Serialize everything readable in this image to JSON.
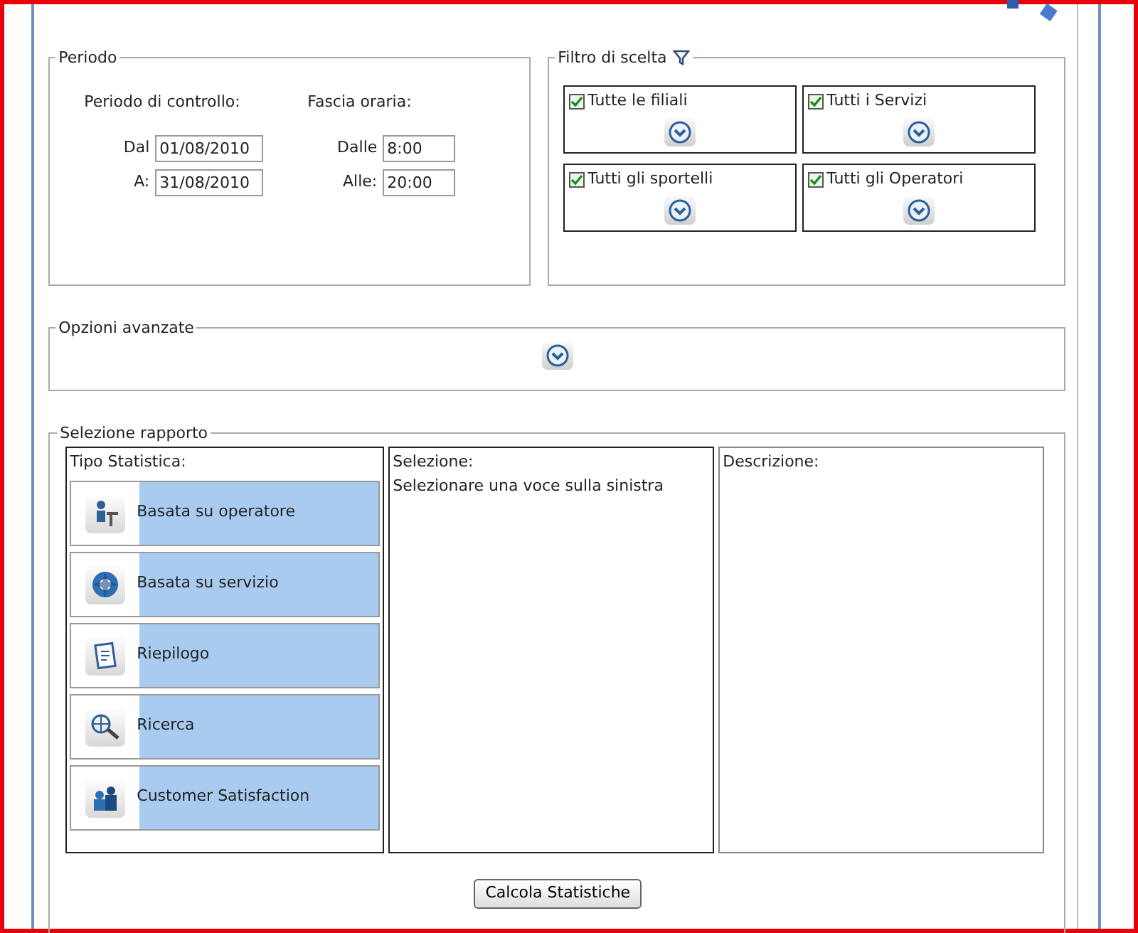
{
  "periodo": {
    "title": "Periodo",
    "control_label": "Periodo di controllo:",
    "time_label": "Fascia oraria:",
    "dates": [
      {
        "label": "Dal",
        "value": "01/08/2010"
      },
      {
        "label": "A:",
        "value": "31/08/2010"
      }
    ],
    "times": [
      {
        "label": "Dalle",
        "value": "8:00"
      },
      {
        "label": "Alle:",
        "value": "20:00"
      }
    ]
  },
  "filtro": {
    "title": "Filtro di scelta",
    "items": [
      {
        "label": "Tutte le filiali",
        "checked": true
      },
      {
        "label": "Tutti i Servizi",
        "checked": true
      },
      {
        "label": "Tutti gli sportelli",
        "checked": true
      },
      {
        "label": "Tutti gli Operatori",
        "checked": true
      }
    ]
  },
  "opzioni": {
    "title": "Opzioni avanzate"
  },
  "selezione": {
    "title": "Selezione rapporto",
    "tipo": {
      "heading": "Tipo Statistica:",
      "items": [
        {
          "label": "Basata su operatore",
          "kind": "operator"
        },
        {
          "label": "Basata su servizio",
          "kind": "service"
        },
        {
          "label": "Riepilogo",
          "kind": "summary"
        },
        {
          "label": "Ricerca",
          "kind": "search"
        },
        {
          "label": "Customer Satisfaction",
          "kind": "satisfaction"
        }
      ]
    },
    "selection_panel": {
      "heading": "Selezione:",
      "text": "Selezionare una voce sulla sinistra"
    },
    "description_panel": {
      "heading": "Descrizione:"
    }
  },
  "button": "Calcola Statistiche"
}
